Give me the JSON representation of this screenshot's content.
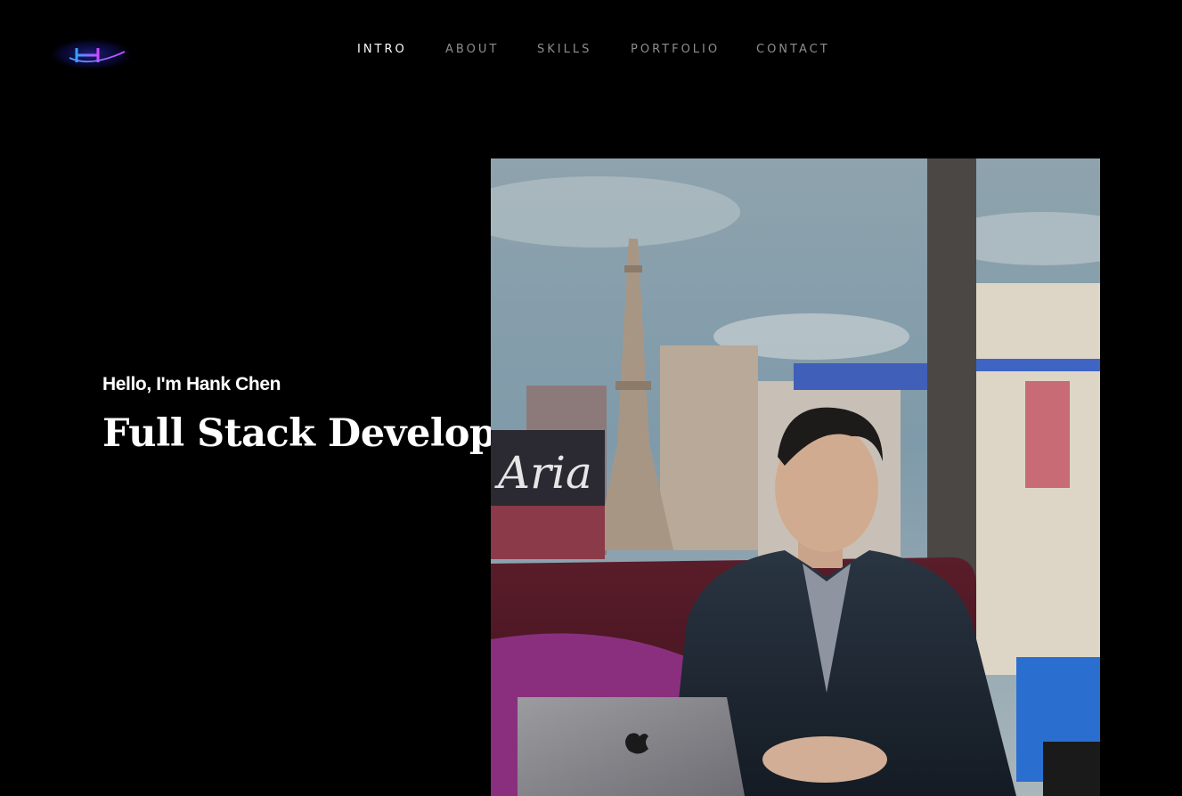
{
  "logo": {
    "text": "H",
    "glow_color": "#2b2bd6",
    "accent_color": "#c04dff"
  },
  "nav": {
    "items": [
      {
        "label": "INTRO",
        "active": true
      },
      {
        "label": "ABOUT",
        "active": false
      },
      {
        "label": "SKILLS",
        "active": false
      },
      {
        "label": "PORTFOLIO",
        "active": false
      },
      {
        "label": "CONTACT",
        "active": false
      }
    ]
  },
  "hero": {
    "greeting": "Hello, I'm Hank Chen",
    "title": "Full Stack Developer"
  },
  "photo": {
    "sign_text": "Aria"
  }
}
